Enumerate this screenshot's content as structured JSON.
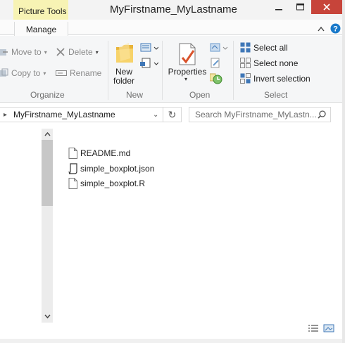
{
  "window": {
    "title": "MyFirstname_MyLastname",
    "contextual_tab_group": "Picture Tools",
    "contextual_tab": "Manage"
  },
  "ribbon": {
    "organize": {
      "label": "Organize",
      "move_to": "Move to",
      "copy_to": "Copy to",
      "delete": "Delete",
      "rename": "Rename"
    },
    "new": {
      "label": "New",
      "new_folder_line1": "New",
      "new_folder_line2": "folder"
    },
    "open": {
      "label": "Open",
      "properties": "Properties"
    },
    "select": {
      "label": "Select",
      "select_all": "Select all",
      "select_none": "Select none",
      "invert_selection": "Invert selection"
    }
  },
  "address": {
    "path": "MyFirstname_MyLastname",
    "search_placeholder": "Search MyFirstname_MyLastn..."
  },
  "files": [
    {
      "name": "README.md",
      "icon": "document-icon"
    },
    {
      "name": "simple_boxplot.json",
      "icon": "script-file-icon"
    },
    {
      "name": "simple_boxplot.R",
      "icon": "document-icon"
    }
  ],
  "colors": {
    "contextual_tab": "#f7f3b4",
    "close_button": "#c7443a",
    "accent_blue": "#1979ca"
  }
}
